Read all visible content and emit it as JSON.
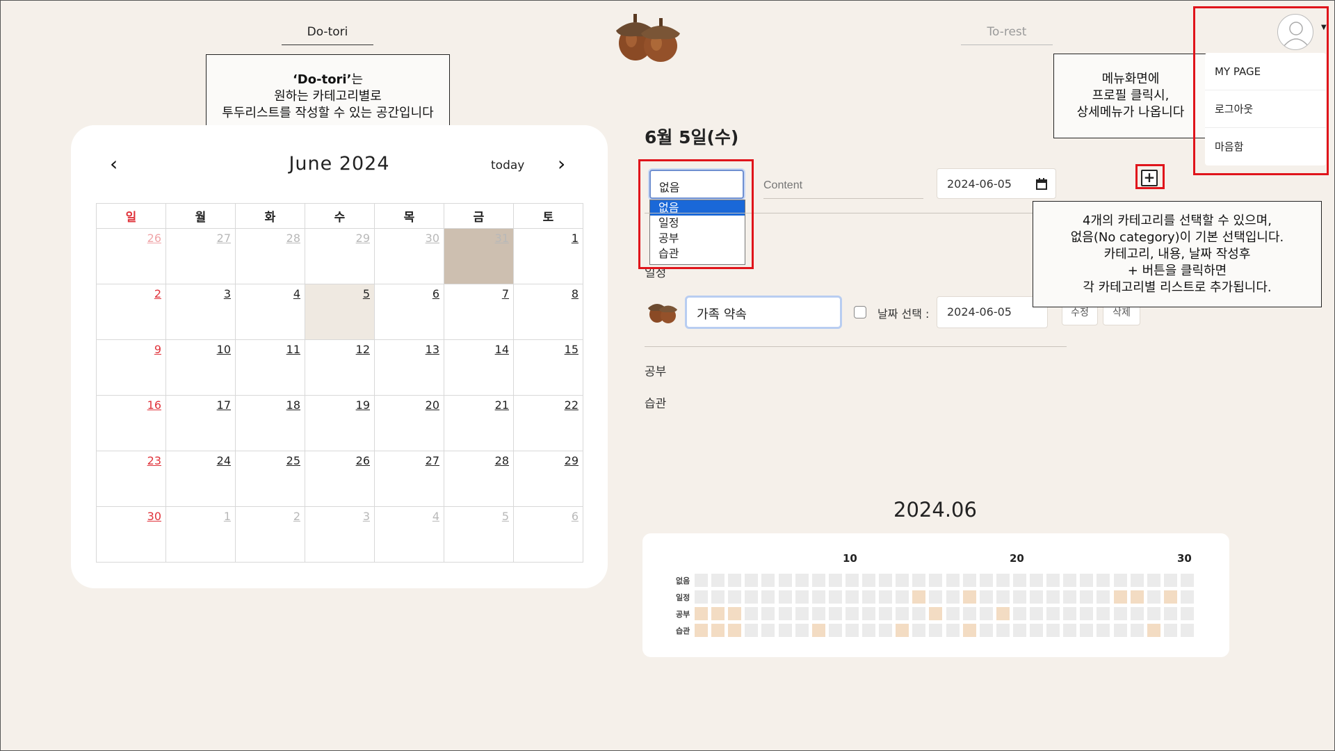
{
  "nav": {
    "left": "Do-tori",
    "right": "To-rest"
  },
  "logo": {
    "icon": "acorn-icon"
  },
  "notes": {
    "dotori": {
      "bold": "‘Do-tori’",
      "suffix": "는",
      "line2": "원하는 카테고리별로",
      "line3": "투두리스트를 작성할 수 있는 공간입니다"
    },
    "menu": {
      "line1": "메뉴화면에",
      "line2": "프로필 클릭시,",
      "line3": "상세메뉴가 나옵니다"
    },
    "category": {
      "line1": "4개의 카테고리를 선택할 수 있으며,",
      "line2": "없음(No category)이 기본 선택입니다.",
      "line3": "카테고리, 내용, 날짜 작성후",
      "line4": "+ 버튼을 클릭하면",
      "line5": "각 카테고리별 리스트로 추가됩니다."
    }
  },
  "calendar": {
    "title": "June 2024",
    "today_label": "today",
    "prev": "‹",
    "next": "›",
    "weekdays": [
      "일",
      "월",
      "화",
      "수",
      "목",
      "금",
      "토"
    ],
    "weeks": [
      [
        "26",
        "27",
        "28",
        "29",
        "30",
        "31",
        "1"
      ],
      [
        "2",
        "3",
        "4",
        "5",
        "6",
        "7",
        "8"
      ],
      [
        "9",
        "10",
        "11",
        "12",
        "13",
        "14",
        "15"
      ],
      [
        "16",
        "17",
        "18",
        "19",
        "20",
        "21",
        "22"
      ],
      [
        "23",
        "24",
        "25",
        "26",
        "27",
        "28",
        "29"
      ],
      [
        "30",
        "1",
        "2",
        "3",
        "4",
        "5",
        "6"
      ]
    ]
  },
  "panel": {
    "date_heading": "6월 5일(수)",
    "category_selected": "없음",
    "category_options": [
      "없음",
      "일정",
      "공부",
      "습관"
    ],
    "content_placeholder": "Content",
    "new_date": "2024-06-05",
    "add_button": "+",
    "sections": {
      "schedule": "일정",
      "study": "공부",
      "habit": "습관"
    },
    "todo": {
      "text": "가족 약속",
      "date_label": "날짜 선택 :",
      "date": "2024-06-05",
      "edit": "수정",
      "delete": "삭제"
    }
  },
  "profile_menu": {
    "items": [
      "MY PAGE",
      "로그아웃",
      "마음함"
    ]
  },
  "heatmap": {
    "title": "2024.06",
    "axis_ticks": [
      "10",
      "20",
      "30"
    ],
    "rows": [
      "없음",
      "일정",
      "공부",
      "습관"
    ],
    "days": 30,
    "active_days": {
      "없음": [],
      "일정": [
        14,
        17,
        26,
        27,
        29
      ],
      "공부": [
        1,
        2,
        3,
        15,
        19
      ],
      "습관": [
        1,
        2,
        3,
        8,
        13,
        17,
        28
      ]
    },
    "colors": {
      "active": "#f3dcc3",
      "inactive": "#ebebeb"
    }
  }
}
